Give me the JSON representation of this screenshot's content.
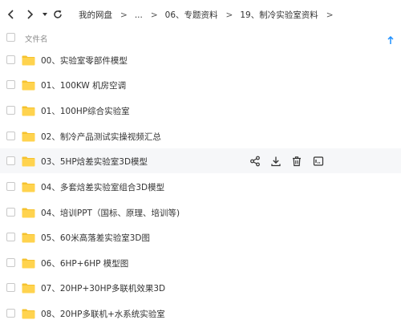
{
  "nav": {
    "icons": [
      "back-icon",
      "forward-icon",
      "dropdown-icon",
      "refresh-icon"
    ],
    "breadcrumb": [
      "我的网盘",
      "...",
      "06、专题资料",
      "19、制冷实验室资料"
    ],
    "separator": ">"
  },
  "list": {
    "header": "文件名",
    "sort_icon": "sort-up-arrow-icon",
    "files": [
      "00、实验室零部件模型",
      "01、100KW 机房空调",
      "01、100HP综合实验室",
      "02、制冷产品测试实操视频汇总",
      "03、5HP焓差实验室3D模型",
      "04、多套焓差实验室组合3D模型",
      "04、培训PPT（国标、原理、培训等)",
      "05、60米高落差实验室3D图",
      "06、6HP+6HP 模型图",
      "07、20HP+30HP多联机效果3D",
      "08、20HP多联机+水系统实验室"
    ],
    "hover_actions": [
      "share-icon",
      "download-icon",
      "delete-icon",
      "more-icon"
    ]
  },
  "colors": {
    "folder": "#ffd34e",
    "folder_tab": "#f5c22e",
    "accent": "#1e90ff",
    "hover_row": "#f6f7f9"
  }
}
